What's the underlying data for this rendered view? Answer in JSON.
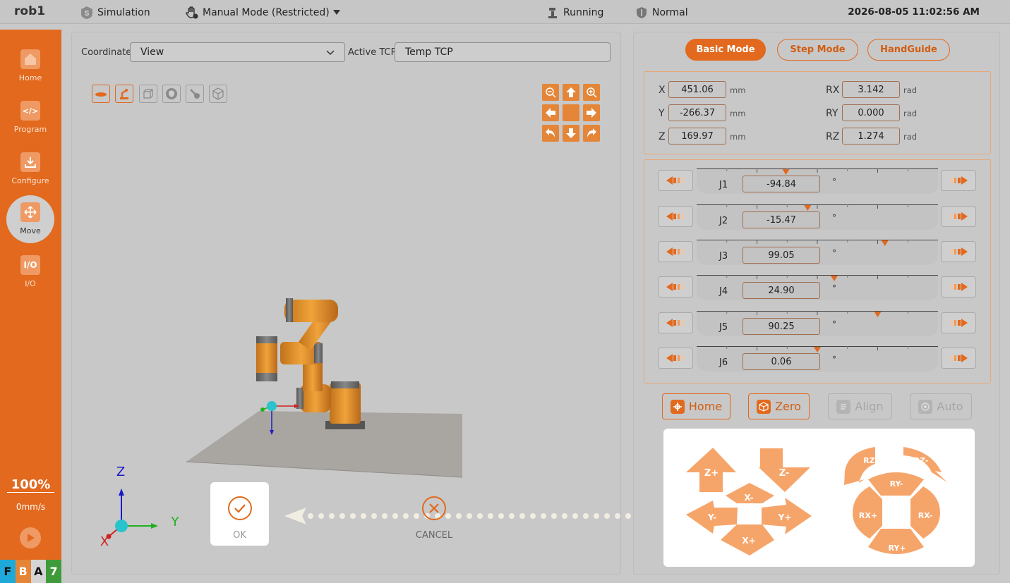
{
  "topbar": {
    "robot_name": "rob1",
    "simulation": "Simulation",
    "mode": "Manual Mode (Restricted)",
    "status": "Running",
    "safety": "Normal",
    "datetime": "2026-08-05 11:02:56 AM"
  },
  "sidebar": {
    "items": [
      {
        "label": "Home"
      },
      {
        "label": "Program"
      },
      {
        "label": "Configure"
      },
      {
        "label": "Move"
      },
      {
        "label": "I/O"
      }
    ],
    "io_icon_text": "I/O",
    "speed_percent": "100%",
    "speed_mm": "0mm/s",
    "badges": [
      {
        "text": "F",
        "color": "#1ea9d8"
      },
      {
        "text": "B",
        "color": "#e48537"
      },
      {
        "text": "A",
        "color": "#d4d4d4"
      },
      {
        "text": "7",
        "color": "#3f9b3a"
      }
    ]
  },
  "left": {
    "coordinate_label": "Coordinate",
    "coordinate_value": "View",
    "tcp_label": "Active TCP",
    "tcp_value": "Temp TCP",
    "axis_labels": {
      "z": "Z",
      "y": "Y",
      "x": "X"
    },
    "dialog": {
      "ok": "OK",
      "cancel": "CANCEL"
    }
  },
  "right": {
    "modes": [
      {
        "label": "Basic Mode",
        "active": true
      },
      {
        "label": "Step Mode",
        "active": false
      },
      {
        "label": "HandGuide",
        "active": false
      }
    ],
    "pose": {
      "x": {
        "label": "X",
        "value": "451.06",
        "unit": "mm"
      },
      "y": {
        "label": "Y",
        "value": "-266.37",
        "unit": "mm"
      },
      "z": {
        "label": "Z",
        "value": "169.97",
        "unit": "mm"
      },
      "rx": {
        "label": "RX",
        "value": "3.142",
        "unit": "rad"
      },
      "ry": {
        "label": "RY",
        "value": "0.000",
        "unit": "rad"
      },
      "rz": {
        "label": "RZ",
        "value": "1.274",
        "unit": "rad"
      }
    },
    "joints": [
      {
        "name": "J1",
        "value": "-94.84",
        "unit": "°",
        "slider": 0.37
      },
      {
        "name": "J2",
        "value": "-15.47",
        "unit": "°",
        "slider": 0.46
      },
      {
        "name": "J3",
        "value": "99.05",
        "unit": "°",
        "slider": 0.78
      },
      {
        "name": "J4",
        "value": "24.90",
        "unit": "°",
        "slider": 0.57
      },
      {
        "name": "J5",
        "value": "90.25",
        "unit": "°",
        "slider": 0.75
      },
      {
        "name": "J6",
        "value": "0.06",
        "unit": "°",
        "slider": 0.5
      }
    ],
    "actions": [
      {
        "label": "Home",
        "enabled": true
      },
      {
        "label": "Zero",
        "enabled": true
      },
      {
        "label": "Align",
        "enabled": false
      },
      {
        "label": "Auto",
        "enabled": false
      }
    ],
    "jog": {
      "z_plus": "Z+",
      "z_minus": "Z-",
      "x_minus": "X-",
      "x_plus": "X+",
      "y_minus": "Y-",
      "y_plus": "Y+",
      "rz_plus": "RZ+",
      "rz_minus": "RZ-",
      "ry_minus": "RY-",
      "ry_plus": "RY+",
      "rx_plus": "RX+",
      "rx_minus": "RX-"
    }
  },
  "colors": {
    "accent": "#e2691d",
    "jog_arrow": "#f6a56a",
    "panel": "#c8c8c8"
  }
}
